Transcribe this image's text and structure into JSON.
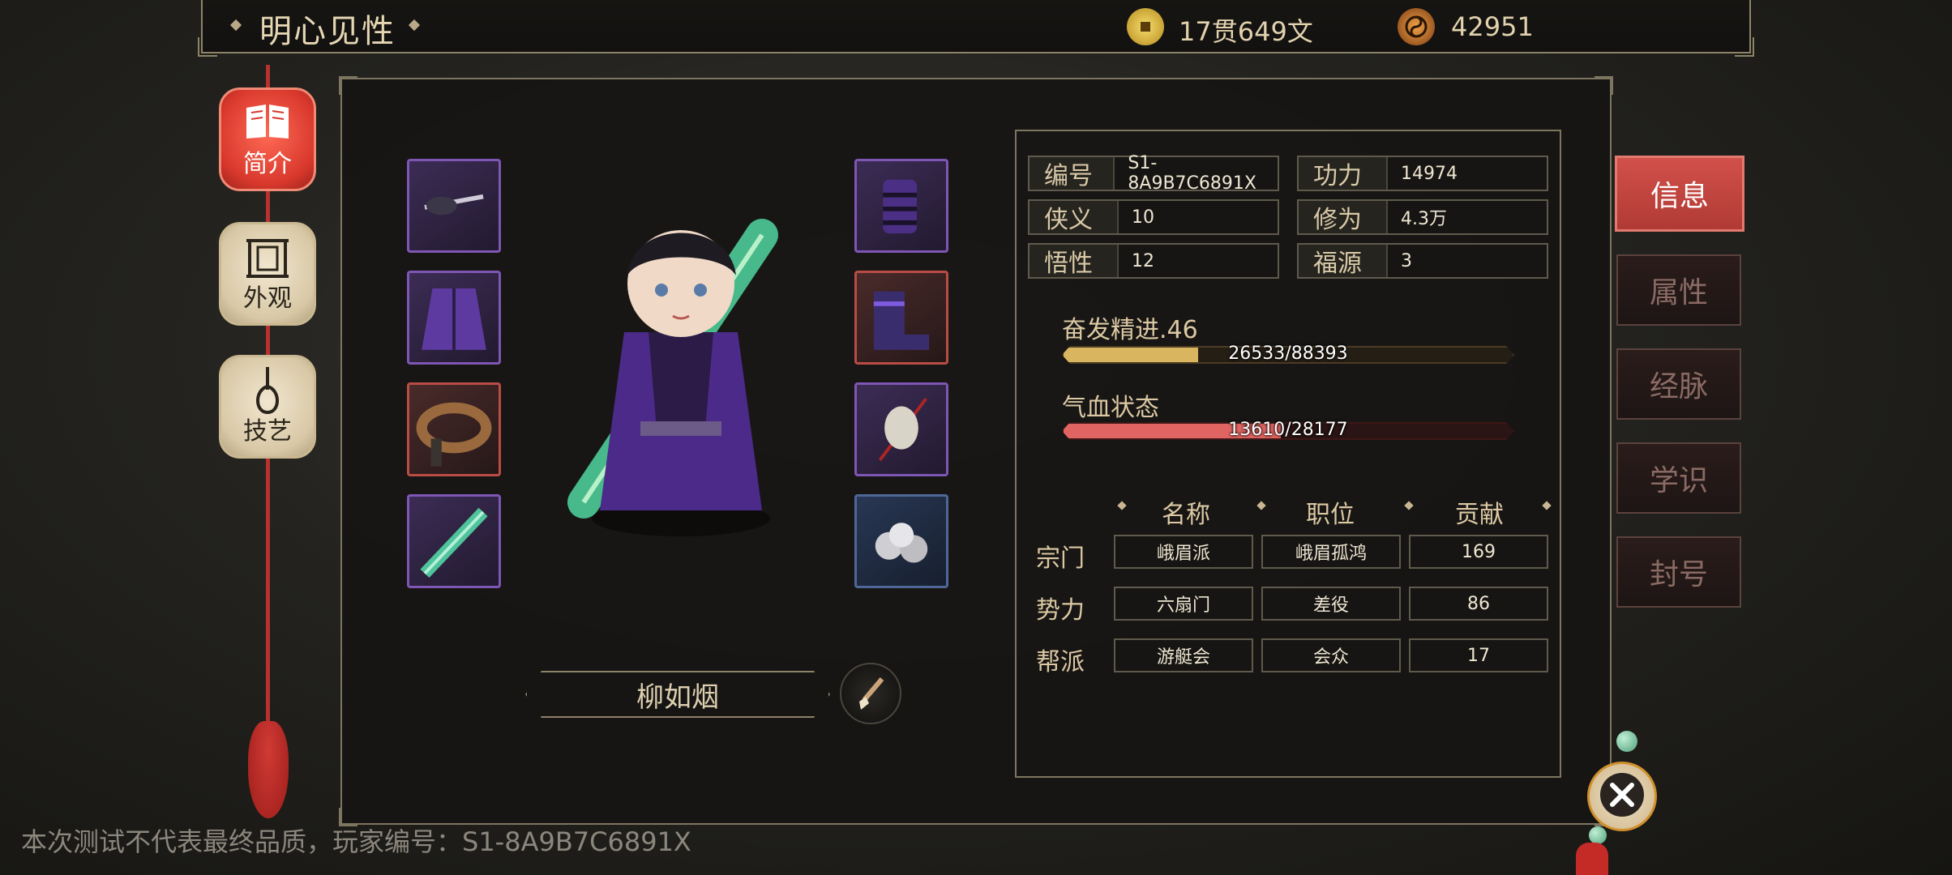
{
  "header": {
    "title": "明心见性",
    "currency": [
      {
        "icon": "copper-coin-icon",
        "value": "17贯649文"
      },
      {
        "icon": "taiji-token-icon",
        "value": "42951"
      }
    ]
  },
  "left_nav": [
    {
      "label": "简介",
      "icon": "book-icon",
      "active": true
    },
    {
      "label": "外观",
      "icon": "mirror-icon",
      "active": false
    },
    {
      "label": "技艺",
      "icon": "pipa-icon",
      "active": false
    }
  ],
  "equipment": {
    "left": [
      {
        "name": "hairpin",
        "rarity": "purple"
      },
      {
        "name": "robe",
        "rarity": "purple"
      },
      {
        "name": "belt",
        "rarity": "red"
      },
      {
        "name": "sword",
        "rarity": "purple"
      }
    ],
    "right": [
      {
        "name": "bracers",
        "rarity": "purple"
      },
      {
        "name": "boots",
        "rarity": "red"
      },
      {
        "name": "jade-pendant",
        "rarity": "purple"
      },
      {
        "name": "iron-balls",
        "rarity": "blue"
      }
    ]
  },
  "character": {
    "name": "柳如烟"
  },
  "info": {
    "fields": [
      {
        "key": "编号",
        "value": "S1-8A9B7C6891X"
      },
      {
        "key": "功力",
        "value": "14974"
      },
      {
        "key": "侠义",
        "value": "10"
      },
      {
        "key": "修为",
        "value": "4.3万"
      },
      {
        "key": "悟性",
        "value": "12"
      },
      {
        "key": "福源",
        "value": "3"
      }
    ],
    "exp": {
      "label": "奋发精进.46",
      "text": "26533/88393",
      "current": 26533,
      "max": 88393,
      "color": "#d8b55e"
    },
    "hp": {
      "label": "气血状态",
      "text": "13610/28177",
      "current": 13610,
      "max": 28177,
      "color": "#e06461"
    },
    "affiliation": {
      "columns": [
        "名称",
        "职位",
        "贡献"
      ],
      "rows": [
        {
          "label": "宗门",
          "cells": [
            "峨眉派",
            "峨眉孤鸿",
            "169"
          ]
        },
        {
          "label": "势力",
          "cells": [
            "六扇门",
            "差役",
            "86"
          ]
        },
        {
          "label": "帮派",
          "cells": [
            "游艇会",
            "会众",
            "17"
          ]
        }
      ]
    }
  },
  "right_tabs": [
    {
      "label": "信息",
      "active": true
    },
    {
      "label": "属性",
      "active": false
    },
    {
      "label": "经脉",
      "active": false
    },
    {
      "label": "学识",
      "active": false
    },
    {
      "label": "封号",
      "active": false
    }
  ],
  "footer_note": "本次测试不代表最终品质，玩家编号：S1-8A9B7C6891X"
}
